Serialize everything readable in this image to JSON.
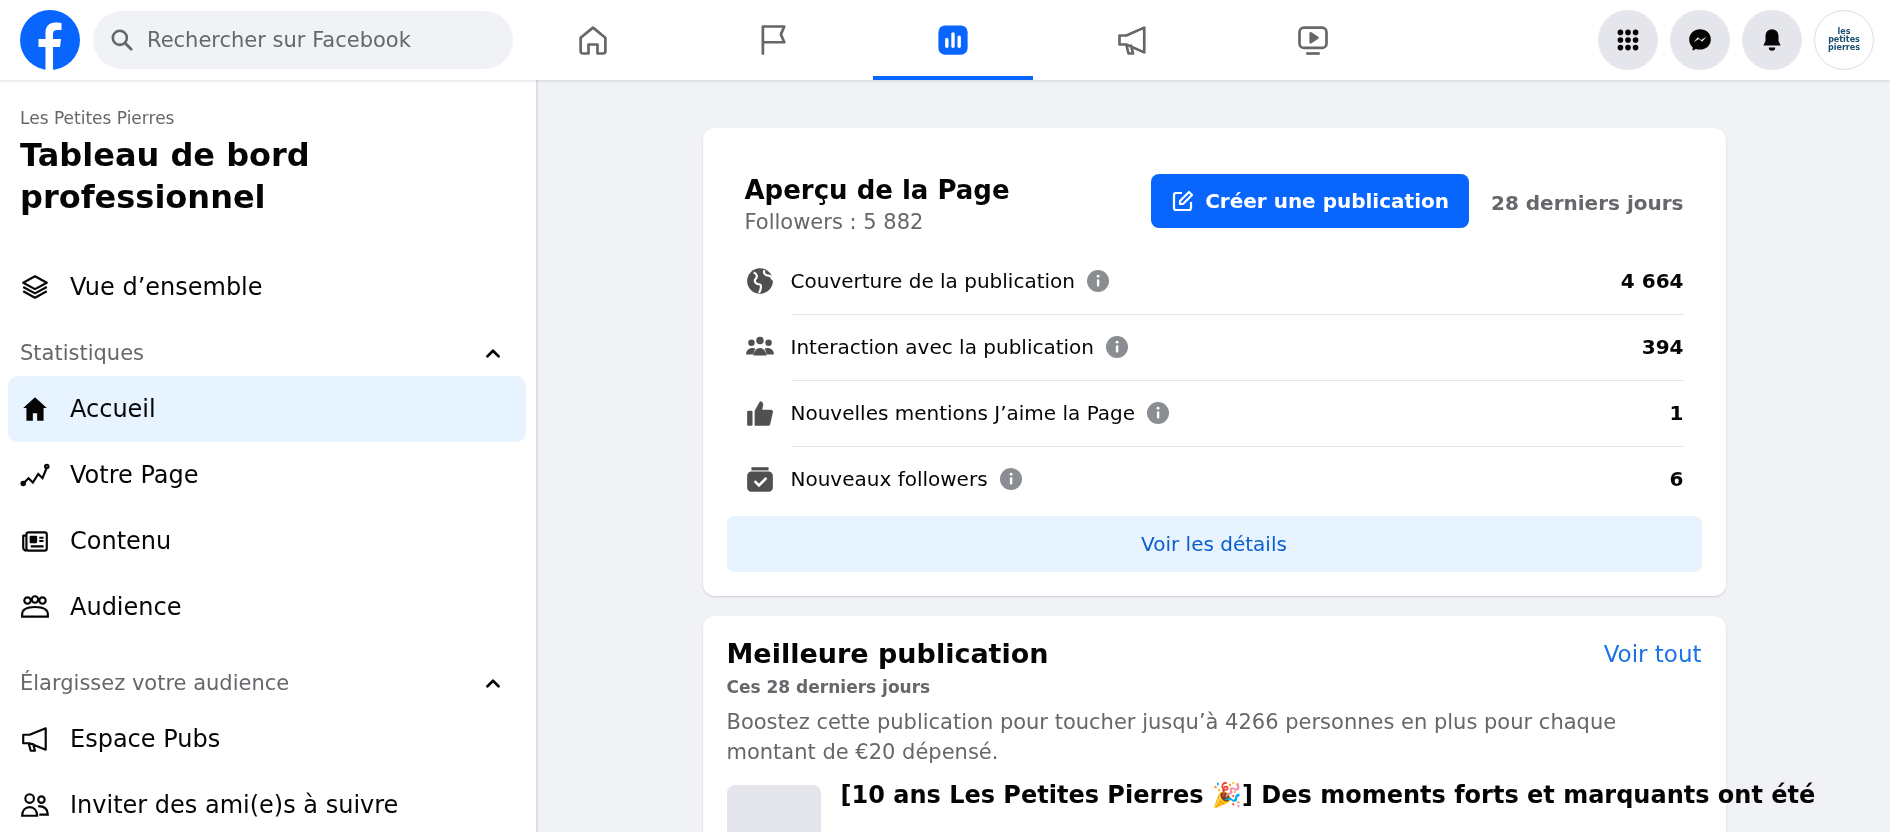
{
  "topbar": {
    "search": {
      "placeholder": "Rechercher sur Facebook"
    },
    "nav_tabs": [
      {
        "kind": "home",
        "selected": false
      },
      {
        "kind": "flag",
        "selected": false
      },
      {
        "kind": "chart",
        "selected": true
      },
      {
        "kind": "megaphone",
        "selected": false
      },
      {
        "kind": "video",
        "selected": false
      }
    ],
    "actions": [
      {
        "kind": "grid"
      },
      {
        "kind": "messenger"
      },
      {
        "kind": "bell"
      }
    ],
    "avatar_text": "les petites pierres"
  },
  "sidebar": {
    "page_name": "Les Petites Pierres",
    "title": "Tableau de bord professionnel",
    "items": [
      {
        "kind": "layers",
        "label": "Vue d’ensemble",
        "selected": false
      }
    ],
    "sections": [
      {
        "title": "Statistiques",
        "expanded": true,
        "items": [
          {
            "kind": "home",
            "label": "Accueil",
            "selected": true
          },
          {
            "kind": "trend",
            "label": "Votre Page",
            "selected": false
          },
          {
            "kind": "news",
            "label": "Contenu",
            "selected": false
          },
          {
            "kind": "people",
            "label": "Audience",
            "selected": false
          }
        ]
      },
      {
        "title": "Élargissez votre audience",
        "expanded": true,
        "items": [
          {
            "kind": "megaphone",
            "label": "Espace Pubs",
            "selected": false
          },
          {
            "kind": "invite",
            "label": "Inviter des ami(e)s à suivre",
            "selected": false
          }
        ]
      }
    ]
  },
  "overview_card": {
    "title": "Aperçu de la Page",
    "followers": "Followers : 5 882",
    "create_button": "Créer une publication",
    "period": "28 derniers jours",
    "metrics": [
      {
        "kind": "globe",
        "label": "Couverture de la publication",
        "value": "4 664"
      },
      {
        "kind": "group",
        "label": "Interaction avec la publication",
        "value": "394"
      },
      {
        "kind": "like",
        "label": "Nouvelles mentions J’aime la Page",
        "value": "1"
      },
      {
        "kind": "follow",
        "label": "Nouveaux followers",
        "value": "6"
      }
    ],
    "details_button": "Voir les détails"
  },
  "best_post_card": {
    "title": "Meilleure publication",
    "link": "Voir tout",
    "subtitle": "Ces 28 derniers jours",
    "description": "Boostez cette publication pour toucher jusqu’à 4266 personnes en plus pour chaque montant de €20 dépensé.",
    "post_text": "[10 ans Les Petites Pierres 🎉] Des moments forts et marquants ont été"
  }
}
